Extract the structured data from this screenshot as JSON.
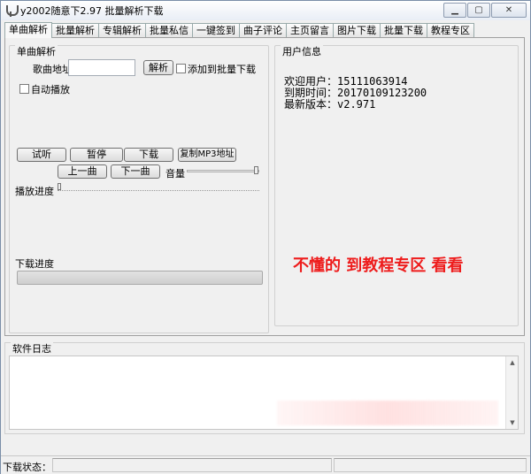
{
  "window": {
    "title": "y2002随意下2.97 批量解析下载",
    "controls": [
      "minimize",
      "maximize",
      "close"
    ]
  },
  "tabs": [
    {
      "label": "单曲解析",
      "active": true
    },
    {
      "label": "批量解析"
    },
    {
      "label": "专辑解析"
    },
    {
      "label": "批量私信"
    },
    {
      "label": "一键签到"
    },
    {
      "label": "曲子评论"
    },
    {
      "label": "主页留言"
    },
    {
      "label": "图片下载"
    },
    {
      "label": "批量下载"
    },
    {
      "label": "教程专区"
    }
  ],
  "single": {
    "group_title": "单曲解析",
    "url_label": "歌曲地址",
    "url_value": "",
    "parse_button": "解析",
    "batch_checkbox": "添加到批量下载",
    "autoplay_checkbox": "自动播放",
    "buttons": {
      "listen": "试听",
      "pause": "暂停",
      "download": "下载",
      "copy_mp3": "复制MP3地址",
      "prev": "上一曲",
      "next": "下一曲"
    },
    "volume_label": "音量",
    "volume_level": 1.0,
    "play_progress_label": "播放进度",
    "play_progress": 0,
    "download_progress_label": "下载进度",
    "download_progress": 0
  },
  "user_info": {
    "group_title": "用户信息",
    "lines": [
      "欢迎用户：15111063914",
      "到期时间：20170109123200",
      "最新版本：v2.971"
    ],
    "promo": "不懂的 到教程专区 看看",
    "promo_color": "#ee1c1c"
  },
  "log": {
    "group_title": "软件日志"
  },
  "status": {
    "label": "下载状态："
  }
}
